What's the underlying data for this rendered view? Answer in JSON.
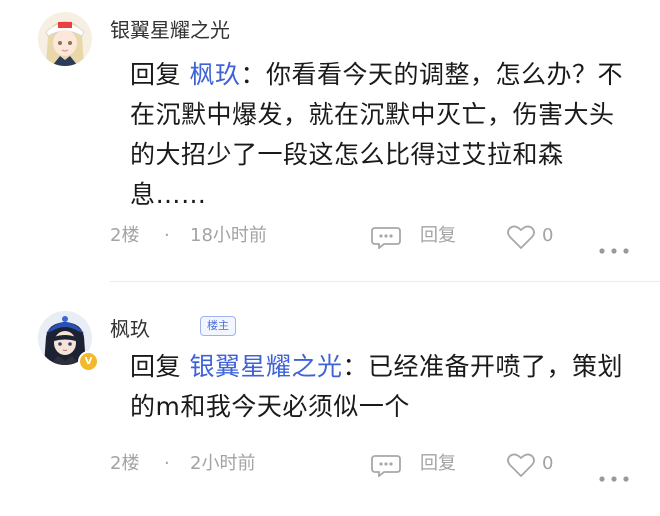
{
  "comments": [
    {
      "username": "银翼星耀之光",
      "reply_prefix": "回复",
      "reply_to": "枫玖",
      "reply_colon": "：",
      "text": "你看看今天的调整，怎么办？不在沉默中爆发，就在沉默中灭亡，伤害大头的大招少了一段这怎么比得过艾拉和森息……",
      "floor": "2楼",
      "separator": "·",
      "time": "18小时前",
      "reply_label": "回复",
      "likes": "0"
    },
    {
      "username": "枫玖",
      "badge": "楼主",
      "reply_prefix": "回复",
      "reply_to": "银翼星耀之光",
      "reply_colon": "：",
      "text": "已经准备开喷了，策划的m和我今天必须似一个",
      "floor": "2楼",
      "separator": "·",
      "time": "2小时前",
      "reply_label": "回复",
      "likes": "0",
      "vip_mark": "V"
    }
  ],
  "colors": {
    "link_blue": "#3f63d6",
    "meta_gray": "#a3a3a3",
    "vip_gold": "#f2b830"
  }
}
